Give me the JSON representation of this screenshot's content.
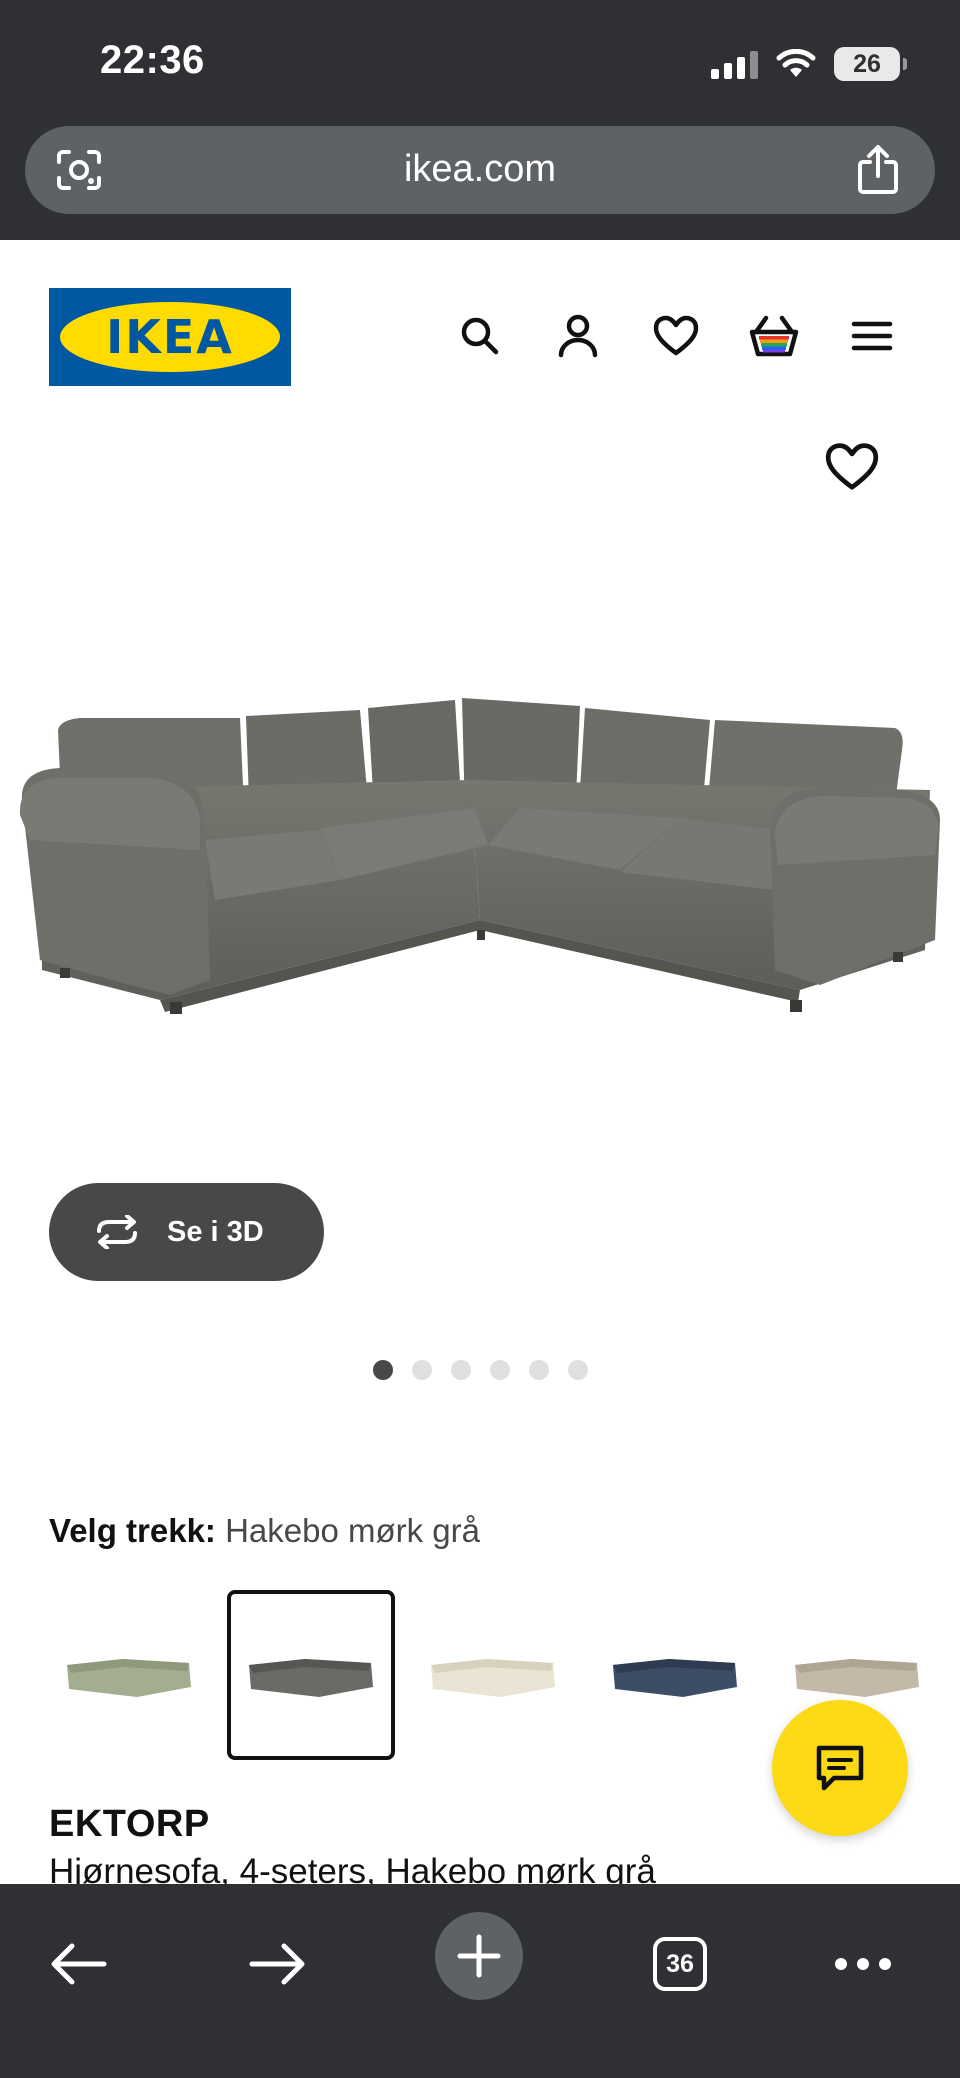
{
  "status": {
    "time": "22:36",
    "battery": "26"
  },
  "browser": {
    "url": "ikea.com",
    "tab_count": "36"
  },
  "brand": {
    "logo_text": "IKEA",
    "blue": "#0058a3",
    "yellow": "#ffdb00"
  },
  "header": {
    "icons": [
      "search-icon",
      "account-icon",
      "wishlist-icon",
      "cart-icon",
      "menu-icon"
    ]
  },
  "product": {
    "view_3d_label": "Se i 3D",
    "gallery_count": 6,
    "gallery_active_index": 0,
    "variant_prefix": "Velg trekk:",
    "variant_value": "Hakebo mørk grå",
    "swatches": [
      {
        "name": "swatch-green",
        "color": "#a3ad90"
      },
      {
        "name": "swatch-dark-grey",
        "color": "#6b6a66"
      },
      {
        "name": "swatch-cream",
        "color": "#e9e4d4"
      },
      {
        "name": "swatch-blue",
        "color": "#3d4d66"
      },
      {
        "name": "swatch-beige",
        "color": "#c4b8a8"
      }
    ],
    "selected_swatch": 1,
    "name": "EKTORP",
    "description": "Hjørnesofa, 4-seters, Hakebo mørk grå",
    "sofa_color": "#6e6d69"
  },
  "chat": {
    "color": "#fbd914"
  }
}
